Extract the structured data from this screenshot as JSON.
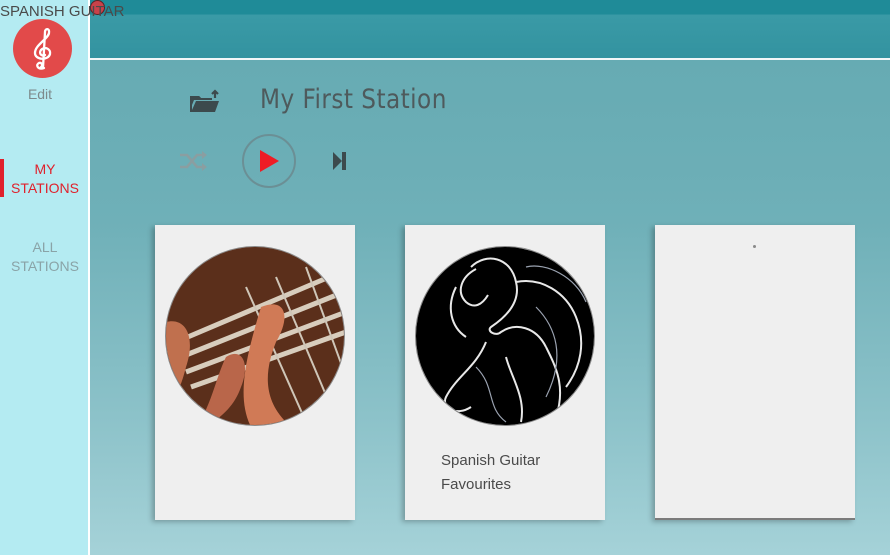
{
  "sidebar": {
    "edit_label": "Edit",
    "nav": [
      {
        "line1": "MY",
        "line2": "STATIONS",
        "active": true
      },
      {
        "line1": "ALL",
        "line2": "STATIONS",
        "active": false
      }
    ]
  },
  "station": {
    "title": "My First Station"
  },
  "playlists": [
    {
      "title": "SPANISH  GUITAR"
    },
    {
      "title_line1": "Spanish  Guitar",
      "title_line2": "Favourites"
    },
    {
      "title": ""
    }
  ],
  "colors": {
    "accent": "#e0212c",
    "logo": "#e24a4a",
    "sidebar": "#b4ebf2",
    "topbar": "#3393a0"
  }
}
